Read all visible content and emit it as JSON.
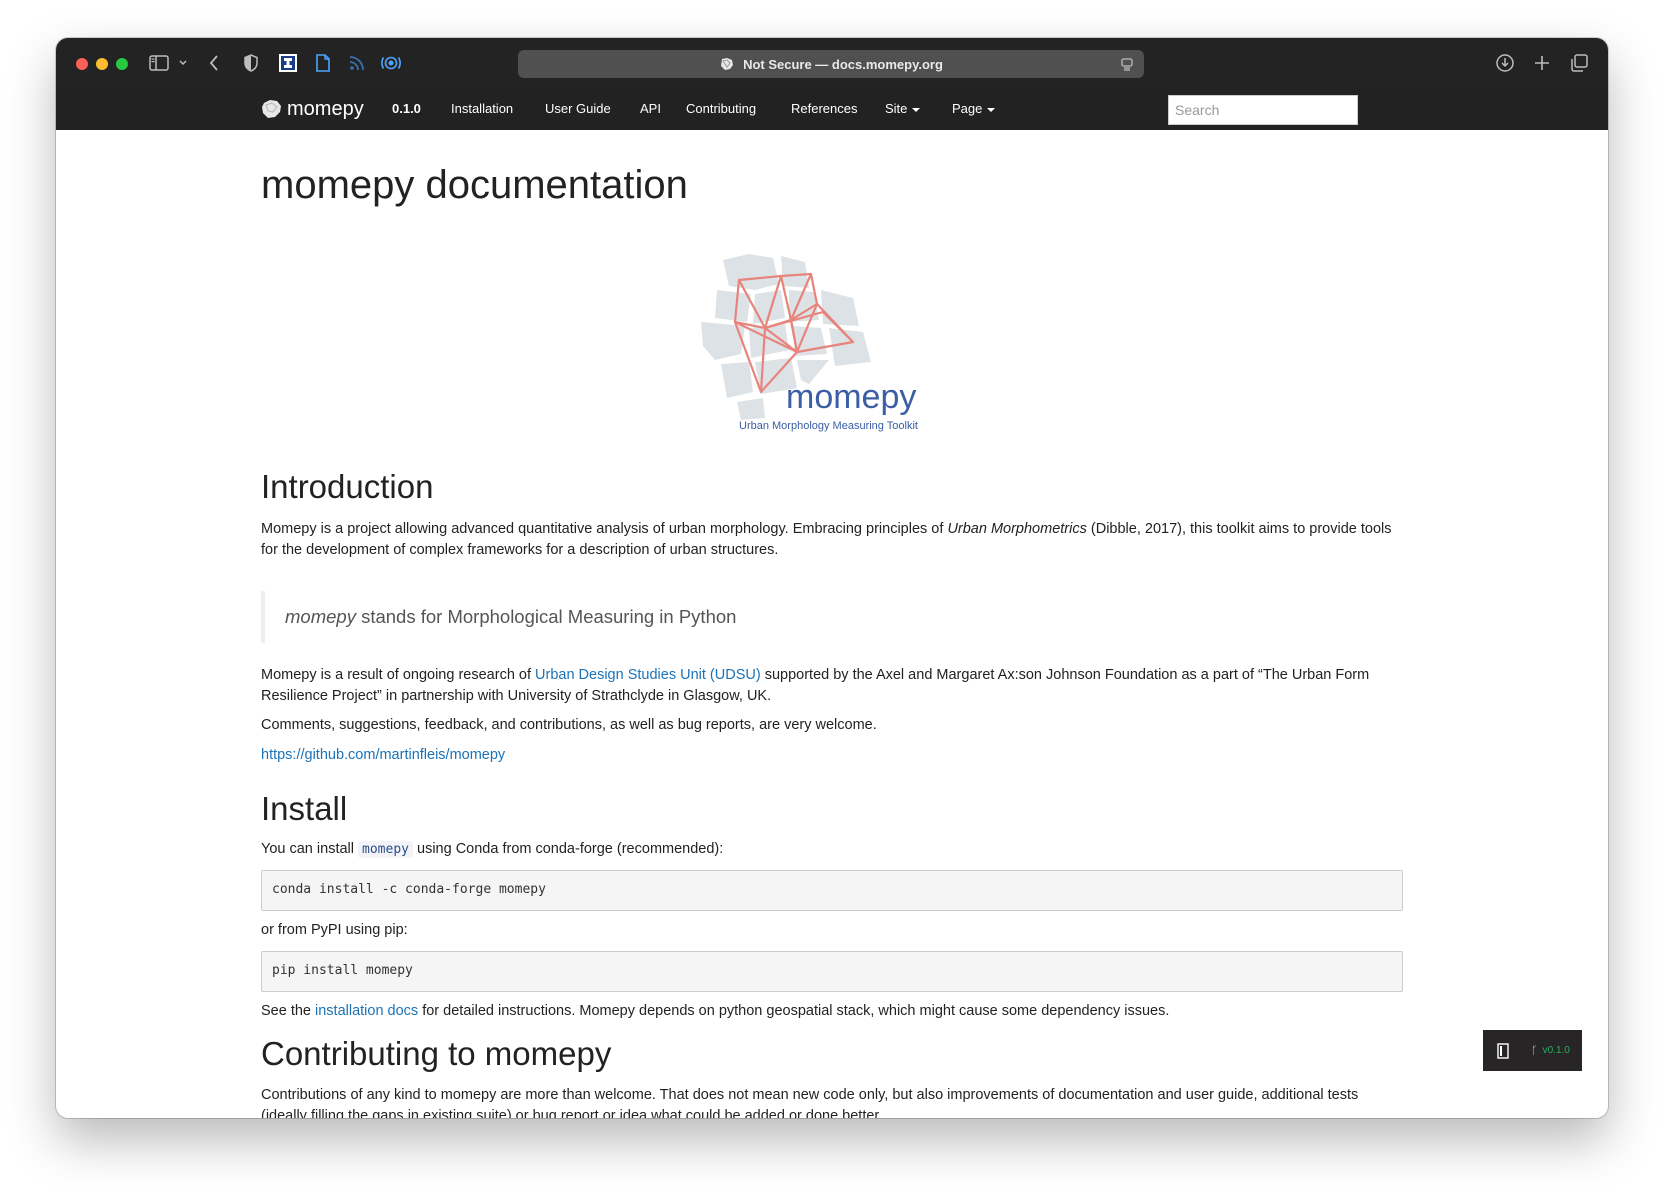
{
  "browser": {
    "url_text": "Not Secure — docs.momepy.org",
    "icons": [
      "sidebar-icon",
      "chevron-down-icon",
      "back-icon",
      "shield-icon",
      "extension-icon",
      "document-icon",
      "rss-icon",
      "broadcast-icon",
      "download-icon",
      "plus-icon",
      "tabs-icon",
      "reader-icon"
    ]
  },
  "navbar": {
    "brand": "momepy",
    "version": "0.1.0",
    "items": [
      {
        "label": "Installation"
      },
      {
        "label": "User Guide"
      },
      {
        "label": "API"
      },
      {
        "label": "Contributing"
      },
      {
        "label": "References"
      },
      {
        "label": "Site",
        "dropdown": true
      },
      {
        "label": "Page",
        "dropdown": true
      }
    ],
    "search_placeholder": "Search"
  },
  "page": {
    "title": "momepy documentation",
    "logo": {
      "word": "momepy",
      "tagline": "Urban Morphology Measuring Toolkit",
      "colors": {
        "blue": "#3b5ea4",
        "red": "#e7847b",
        "grey": "#dde2e6"
      }
    },
    "intro": {
      "heading": "Introduction",
      "p1_before": "Momepy is a project allowing advanced quantitative analysis of urban morphology. Embracing principles of ",
      "p1_em": "Urban Morphometrics",
      "p1_after": " (Dibble, 2017), this toolkit aims to provide tools for the development of complex frameworks for a description of urban structures.",
      "quote_em": "momepy",
      "quote_rest": " stands for Morphological Measuring in Python",
      "p2_before": "Momepy is a result of ongoing research of ",
      "p2_link": "Urban Design Studies Unit (UDSU)",
      "p2_after": " supported by the Axel and Margaret Ax:son Johnson Foundation as a part of “The Urban Form Resilience Project” in partnership with University of Strathclyde in Glasgow, UK.",
      "p3": "Comments, suggestions, feedback, and contributions, as well as bug reports, are very welcome.",
      "repo_link": "https://github.com/martinfleis/momepy"
    },
    "install": {
      "heading": "Install",
      "p1_before": "You can install ",
      "p1_code": "momepy",
      "p1_after": " using Conda from conda-forge (recommended):",
      "code1": "conda install -c conda-forge momepy",
      "p2": "or from PyPI using pip:",
      "code2": "pip install momepy",
      "p3_before": "See the ",
      "p3_link": "installation docs",
      "p3_after": " for detailed instructions. Momepy depends on python geospatial stack, which might cause some dependency issues."
    },
    "contributing": {
      "heading": "Contributing to momepy",
      "p1": "Contributions of any kind to momepy are more than welcome. That does not mean new code only, but also improvements of documentation and user guide, additional tests (ideally filling the gaps in existing suite) or bug report or idea what could be added or done better."
    }
  },
  "rtd_badge": {
    "branch_label": "ᚴ",
    "version": "v0.1.0"
  }
}
